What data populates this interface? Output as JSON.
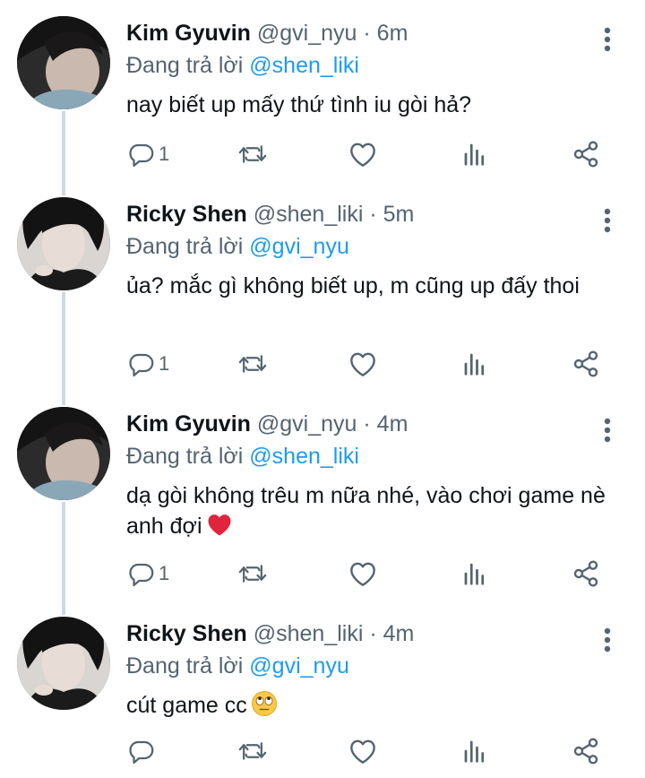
{
  "tweets": [
    {
      "name": "Kim Gyuvin",
      "handle": "@gvi_nyu",
      "dot": "·",
      "time": "6m",
      "reply_prefix": "Đang trả lời",
      "reply_to": "@shen_liki",
      "text": "nay biết up mấy thứ tình iu gòi hả?",
      "reply_count": "1"
    },
    {
      "name": "Ricky Shen",
      "handle": "@shen_liki",
      "dot": "·",
      "time": "5m",
      "reply_prefix": "Đang trả lời",
      "reply_to": "@gvi_nyu",
      "text": "ủa? mắc gì không biết up, m cũng up đấy thoi",
      "reply_count": "1"
    },
    {
      "name": "Kim Gyuvin",
      "handle": "@gvi_nyu",
      "dot": "·",
      "time": "4m",
      "reply_prefix": "Đang trả lời",
      "reply_to": "@shen_liki",
      "text": "dạ gòi không trêu m nữa nhé, vào chơi game nè anh đợi",
      "emoji": "red-heart",
      "reply_count": "1"
    },
    {
      "name": "Ricky Shen",
      "handle": "@shen_liki",
      "dot": "·",
      "time": "4m",
      "reply_prefix": "Đang trả lời",
      "reply_to": "@gvi_nyu",
      "text": "cút game cc",
      "emoji": "face-with-rolling-eyes",
      "reply_count": ""
    }
  ],
  "icons": {
    "more": "more-vertical-icon",
    "reply": "reply-icon",
    "retweet": "retweet-icon",
    "like": "heart-icon",
    "views": "analytics-icon",
    "share": "share-icon"
  },
  "colors": {
    "name": "#0f1419",
    "secondary": "#536471",
    "mention": "#1d9bf0",
    "thread_line": "#cfd9de",
    "heart_emoji": "#e0243c"
  }
}
